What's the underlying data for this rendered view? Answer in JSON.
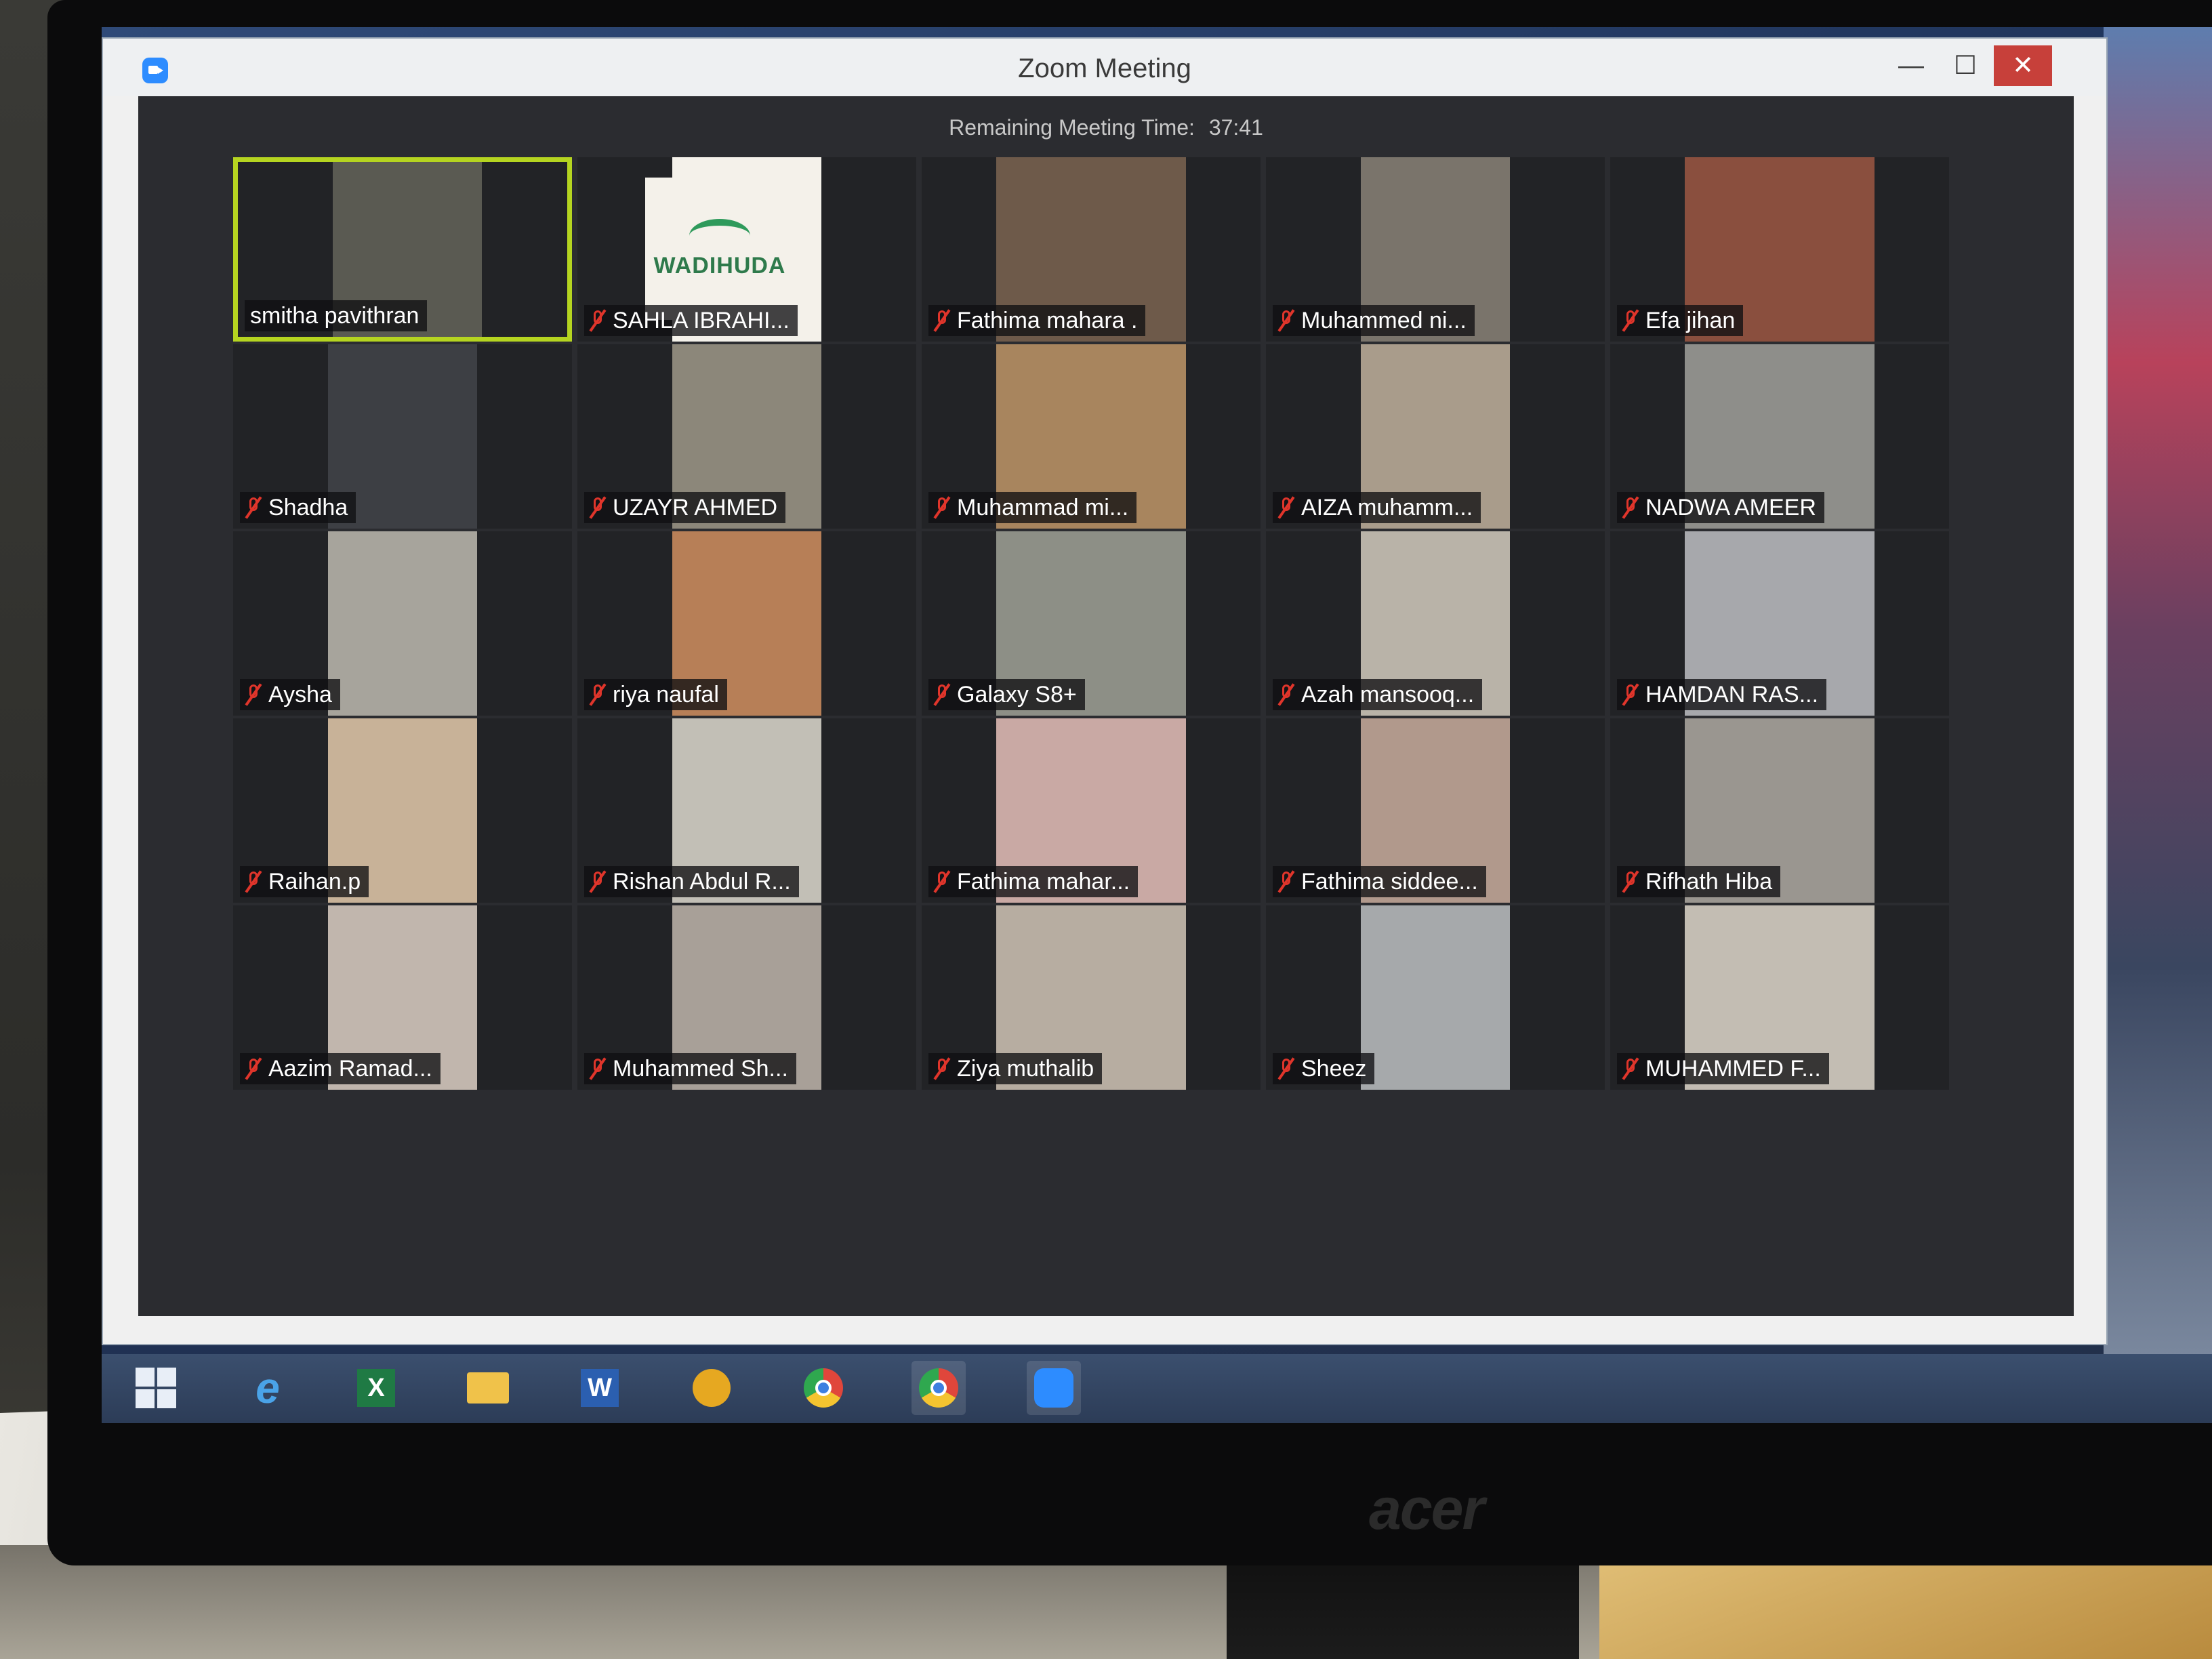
{
  "window": {
    "title": "Zoom Meeting",
    "minimize": "—",
    "maximize": "☐",
    "close": "✕"
  },
  "meeting": {
    "remaining_label": "Remaining Meeting Time:",
    "remaining_time": "37:41"
  },
  "participants": [
    {
      "name": "smitha pavithran",
      "muted": false,
      "active_speaker": true,
      "video_bg": "#5a5a52"
    },
    {
      "name": "SAHLA IBRAHI...",
      "muted": true,
      "logo_text": "WADIHUDA",
      "video_bg": "#f4f1ea"
    },
    {
      "name": "Fathima mahara .",
      "muted": true,
      "video_bg": "#6e5a4a"
    },
    {
      "name": "Muhammed ni...",
      "muted": true,
      "video_bg": "#7a746b"
    },
    {
      "name": "Efa jihan",
      "muted": true,
      "video_bg": "#8a4f3e"
    },
    {
      "name": "Shadha",
      "muted": true,
      "video_bg": "#3d3f44"
    },
    {
      "name": "UZAYR AHMED",
      "muted": true,
      "video_bg": "#8c877a"
    },
    {
      "name": "Muhammad mi...",
      "muted": true,
      "video_bg": "#a8855e"
    },
    {
      "name": "AIZA muhamm...",
      "muted": true,
      "video_bg": "#a99c8b"
    },
    {
      "name": "NADWA AMEER",
      "muted": true,
      "video_bg": "#8e8e8a"
    },
    {
      "name": "Aysha",
      "muted": true,
      "video_bg": "#a7a49c"
    },
    {
      "name": "riya naufal",
      "muted": true,
      "video_bg": "#b77f57"
    },
    {
      "name": "Galaxy S8+",
      "muted": true,
      "video_bg": "#8d8f86"
    },
    {
      "name": "Azah mansooq...",
      "muted": true,
      "video_bg": "#b9b3a8"
    },
    {
      "name": "HAMDAN RAS...",
      "muted": true,
      "video_bg": "#a7a8ac"
    },
    {
      "name": "Raihan.p",
      "muted": true,
      "video_bg": "#c8b298"
    },
    {
      "name": "Rishan Abdul R...",
      "muted": true,
      "video_bg": "#c2bfb6"
    },
    {
      "name": "Fathima mahar...",
      "muted": true,
      "video_bg": "#c9a9a4"
    },
    {
      "name": "Fathima siddee...",
      "muted": true,
      "video_bg": "#b1998c"
    },
    {
      "name": "Rifhath Hiba",
      "muted": true,
      "video_bg": "#9a9690"
    },
    {
      "name": "Aazim    Ramad...",
      "muted": true,
      "video_bg": "#c1b6ad"
    },
    {
      "name": "Muhammed Sh...",
      "muted": true,
      "video_bg": "#a8a098"
    },
    {
      "name": "Ziya muthalib",
      "muted": true,
      "video_bg": "#b7ada1"
    },
    {
      "name": "Sheez",
      "muted": true,
      "video_bg": "#a6a9ab"
    },
    {
      "name": "MUHAMMED F...",
      "muted": true,
      "video_bg": "#c3bdb3"
    }
  ],
  "taskbar": [
    {
      "icon": "windows-start-icon"
    },
    {
      "icon": "internet-explorer-icon"
    },
    {
      "icon": "excel-icon"
    },
    {
      "icon": "file-explorer-icon"
    },
    {
      "icon": "word-icon"
    },
    {
      "icon": "outlook-icon"
    },
    {
      "icon": "chrome-icon"
    },
    {
      "icon": "chrome-icon"
    },
    {
      "icon": "zoom-icon"
    }
  ],
  "monitor_brand": "acer"
}
